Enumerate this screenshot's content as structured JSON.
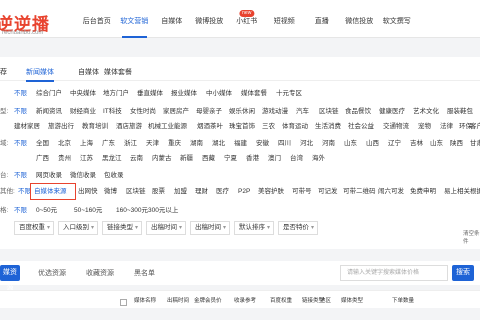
{
  "logo": {
    "mark": "逆逆播",
    "url": "rechuanbo.com"
  },
  "nav": {
    "items": [
      "后台首页",
      "软文营销",
      "自媒体",
      "微博投放",
      "小红书",
      "短视频",
      "直播",
      "微信投放",
      "软文撰写"
    ],
    "active_index": 1,
    "new_badge": "new"
  },
  "tabs": [
    "荐",
    "新闻媒体",
    "自媒体",
    "媒体套餐"
  ],
  "filters": {
    "portal": {
      "label": "",
      "items": [
        "不限",
        "综合门户",
        "中央媒体",
        "地方门户",
        "垂直媒体",
        "报业媒体",
        "中小媒体",
        "媒体套餐",
        "十元专区"
      ]
    },
    "category_row1": {
      "label": "型:",
      "items": [
        "不限",
        "新闻资讯",
        "财经商业",
        "IT科技",
        "女性时尚",
        "家居房产",
        "母婴亲子",
        "娱乐休闲",
        "游戏动漫",
        "汽车",
        "区块链",
        "食品餐饮",
        "健康医疗",
        "艺术文化",
        "服装鞋包"
      ]
    },
    "category_row2": {
      "items": [
        "建材家居",
        "旅游出行",
        "教育培训",
        "酒店旅游",
        "机械工业能源",
        "烟酒茶叶",
        "珠宝首饰",
        "三农",
        "体育运动",
        "生活消费",
        "社会公益",
        "交通物流",
        "宠物",
        "法律",
        "环保",
        "客户整合"
      ]
    },
    "region_row1": {
      "label": "域:",
      "items": [
        "不限",
        "全国",
        "北京",
        "上海",
        "广东",
        "浙江",
        "天津",
        "重庆",
        "湖南",
        "湖北",
        "福建",
        "安徽",
        "四川",
        "河北",
        "河南",
        "山东",
        "山西",
        "辽宁",
        "吉林",
        "山东",
        "陕西",
        "甘肃"
      ]
    },
    "region_row2": {
      "items": [
        "广西",
        "贵州",
        "江苏",
        "黑龙江",
        "云南",
        "内蒙古",
        "新疆",
        "西藏",
        "宁夏",
        "香港",
        "澳门",
        "台湾",
        "海外"
      ]
    },
    "platform": {
      "label": "台:",
      "items": [
        "不限",
        "网页收录",
        "微信收录",
        "包收录"
      ]
    },
    "feature": {
      "label": "其他:",
      "items": [
        "不限",
        "自媒体来源",
        "出网快",
        "微博",
        "区块链",
        "股票",
        "加盟",
        "理财",
        "医疗",
        "P2P",
        "美容护肤",
        "可带号",
        "可记发",
        "可带二维码",
        "闹六可发",
        "免费申明",
        "易上相关",
        "根据保障"
      ]
    },
    "price": {
      "label": "格:",
      "items": [
        "不限",
        "0~50元",
        "50~160元",
        "160~300元",
        "300元以上"
      ]
    }
  },
  "selects": [
    "百度权重",
    "入口级别",
    "链接类型",
    "出稿时间",
    "出稿时间",
    "默认排序",
    "是否特价"
  ],
  "clear_label": "清空条件",
  "bottom": {
    "primary_tab": "媒资源",
    "tabs": [
      "优选资源",
      "收藏资源",
      "黑名单"
    ],
    "search_placeholder": "请输入关键字搜索媒体价格",
    "search_button": "搜索"
  },
  "table_headers": [
    "媒体名称",
    "出稿时间",
    "金牌会员价",
    "收录参考",
    "百度权重",
    "链接类型",
    "地区",
    "媒体类型",
    "下单数量"
  ],
  "colors": {
    "accent": "#1e63d6",
    "brand": "#e8432e"
  }
}
